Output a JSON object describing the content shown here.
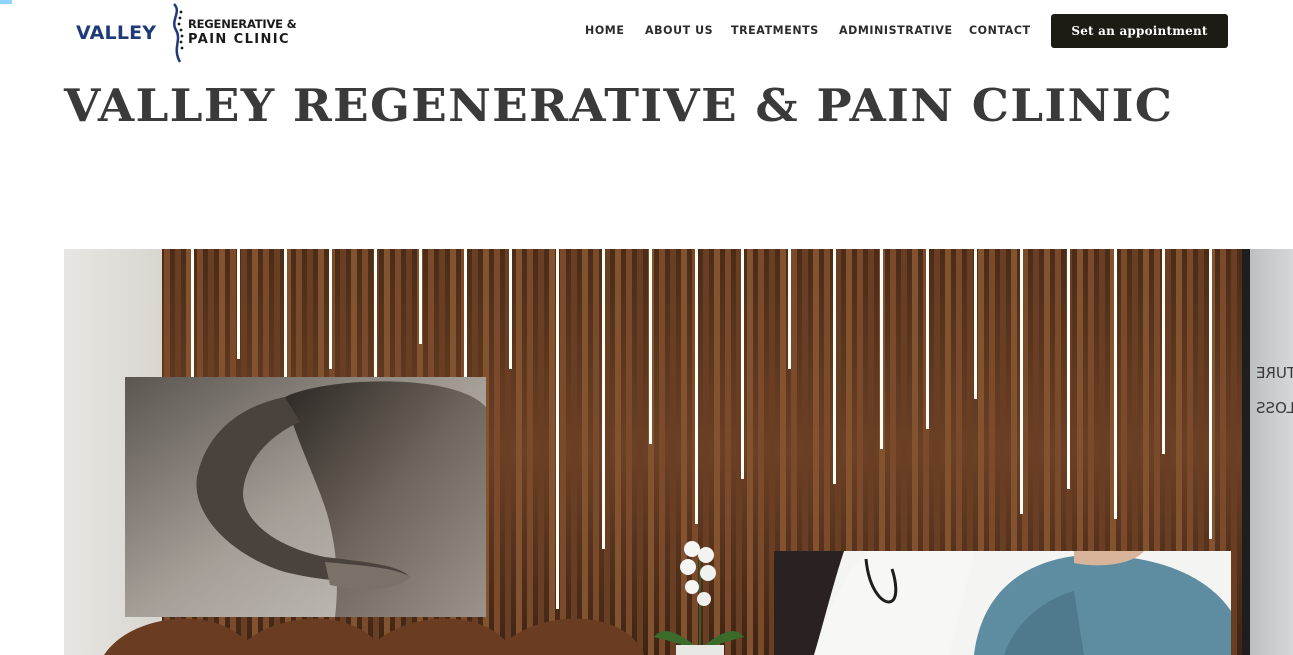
{
  "logo": {
    "word": "VALLEY",
    "line1": "REGENERATIVE &",
    "line2": "PAIN CLINIC"
  },
  "nav": {
    "items": [
      "HOME",
      "ABOUT US",
      "TREATMENTS",
      "ADMINISTRATIVE",
      "CONTACT"
    ]
  },
  "cta": {
    "label": "Set an appointment"
  },
  "page_title": "VALLEY REGENERATIVE & PAIN CLINIC",
  "hero": {
    "window_text_1": "TURE",
    "window_text_2": "LOSS"
  },
  "colors": {
    "logo_blue": "#1e3a78",
    "button_bg": "#1c1c14",
    "title_text": "#3a3a3a",
    "wood": "#5a3620"
  }
}
